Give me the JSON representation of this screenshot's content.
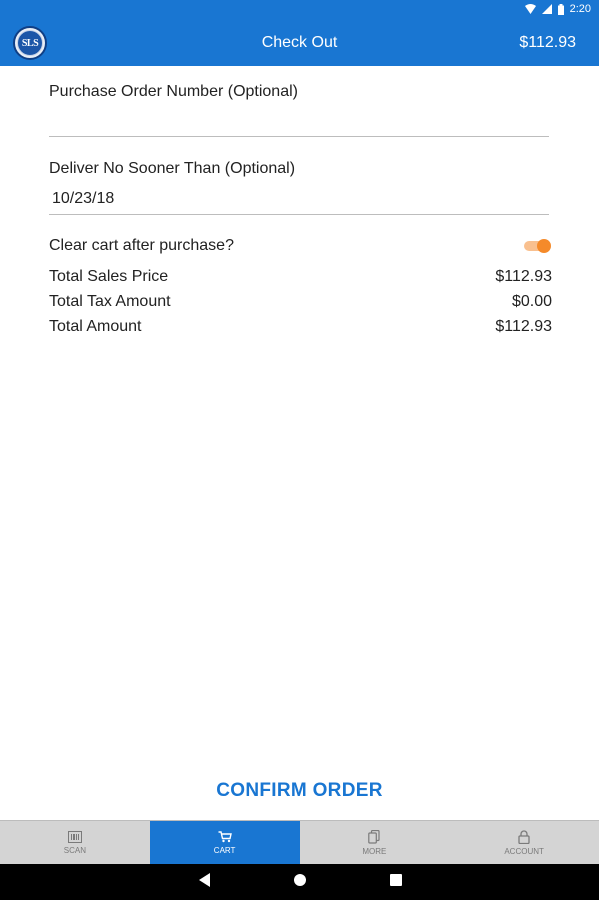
{
  "status_bar": {
    "time": "2:20"
  },
  "app_bar": {
    "logo_text": "SLS",
    "title": "Check Out",
    "total": "$112.93"
  },
  "form": {
    "po_label": "Purchase Order Number (Optional)",
    "po_value": "",
    "deliver_label": "Deliver No Sooner Than (Optional)",
    "deliver_value": "10/23/18"
  },
  "clear_cart": {
    "label": "Clear cart after purchase?",
    "enabled": true
  },
  "totals": [
    {
      "label": "Total Sales Price",
      "value": "$112.93"
    },
    {
      "label": "Total Tax Amount",
      "value": "$0.00"
    },
    {
      "label": "Total Amount",
      "value": "$112.93"
    }
  ],
  "confirm_label": "CONFIRM ORDER",
  "tabs": [
    {
      "label": "SCAN",
      "icon": "barcode-icon",
      "active": false
    },
    {
      "label": "CART",
      "icon": "cart-icon",
      "active": true
    },
    {
      "label": "MORE",
      "icon": "documents-icon",
      "active": false
    },
    {
      "label": "ACCOUNT",
      "icon": "lock-icon",
      "active": false
    }
  ],
  "colors": {
    "primary": "#1976d2",
    "toggle_accent": "#f58a2a",
    "tab_bar": "#d4d4d4"
  }
}
